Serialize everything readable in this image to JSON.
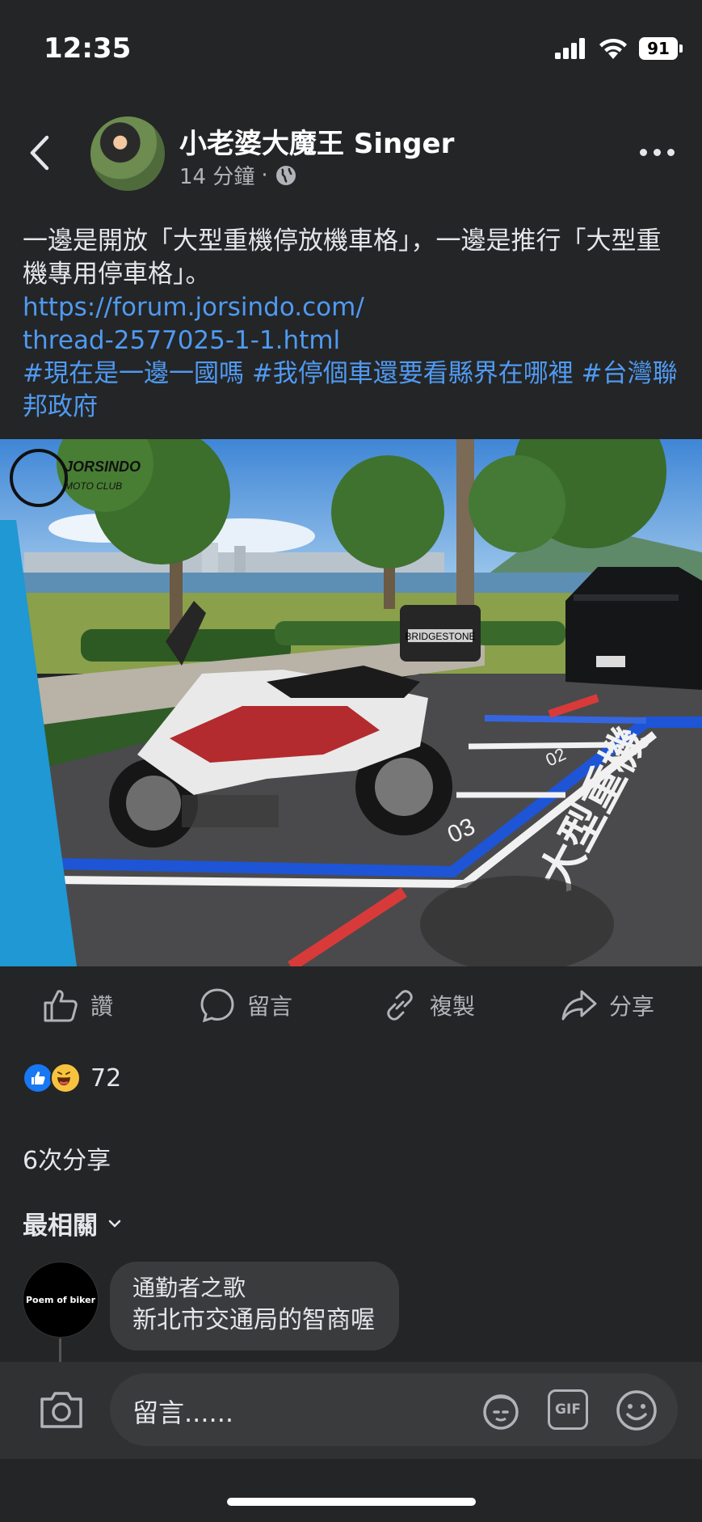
{
  "status": {
    "time": "12:35",
    "battery": "91"
  },
  "post": {
    "author": "小老婆大魔王 Singer",
    "time": "14 分鐘",
    "text": "一邊是開放「大型重機停放機車格」，一邊是推行「大型重機專用停車格」。",
    "link_line1": "https://forum.jorsindo.com/",
    "link_line2": "thread-2577025-1-1.html",
    "hashtags": "#現在是一邊一國嗎 #我停個車還要看縣界在哪裡 #台灣聯邦政府"
  },
  "photo": {
    "watermark": "JORSINDO",
    "watermark_sub": "MOTO CLUB",
    "box_brand": "BRIDGESTONE",
    "slot_number_1": "03",
    "slot_number_2": "02",
    "road_marking": "大型重機"
  },
  "actions": {
    "like": "讚",
    "comment": "留言",
    "copy": "複製",
    "share": "分享"
  },
  "reactions": {
    "count": "72"
  },
  "shares": "6次分享",
  "sort_label": "最相關",
  "comment": {
    "avatar_text": "Poem of biker",
    "name": "通勤者之歌",
    "text": "新北市交通局的智商喔"
  },
  "composer": {
    "placeholder": "留言......"
  },
  "colors": {
    "background": "#242526",
    "link": "#4f9af2",
    "like_blue": "#1877f2"
  },
  "icons": [
    "back-icon",
    "globe-icon",
    "more-icon",
    "thumb-up-icon",
    "comment-icon",
    "link-icon",
    "share-icon",
    "camera-icon",
    "avatar-sticker-icon",
    "gif-icon",
    "emoji-icon"
  ]
}
